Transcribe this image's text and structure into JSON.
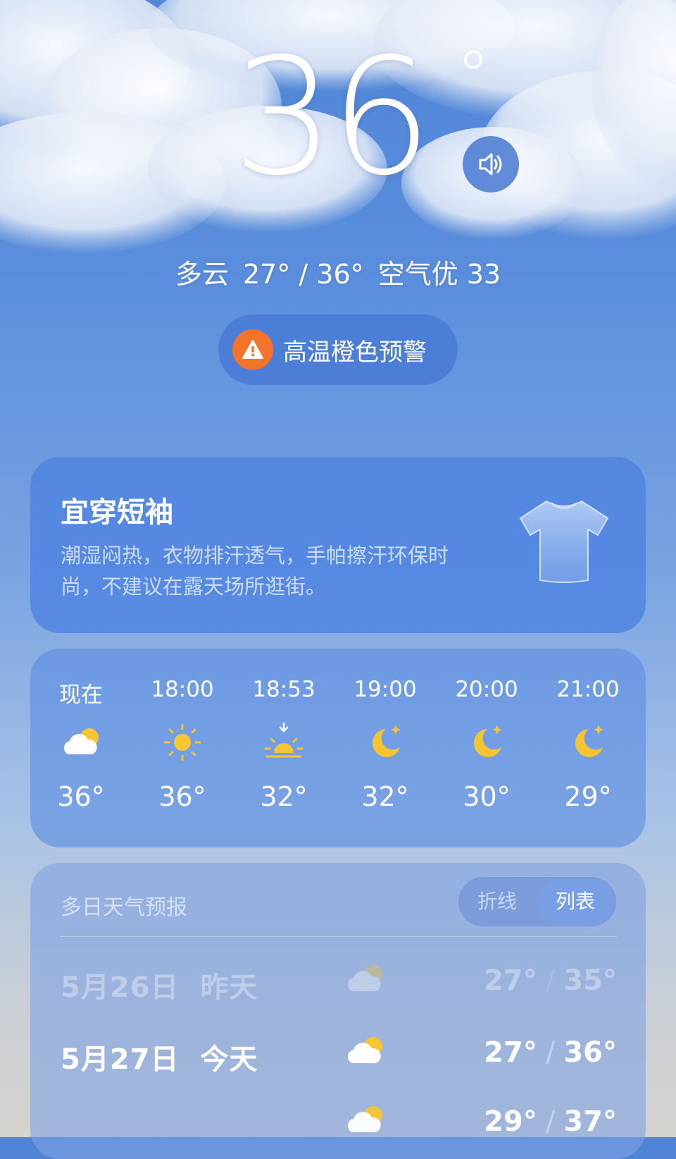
{
  "current": {
    "temperature": "36",
    "degree_symbol": "°",
    "condition": "多云",
    "range": "27° / 36°",
    "air_quality": "空气优 33"
  },
  "alert": {
    "label": "高温橙色预警",
    "color": "#f3732b"
  },
  "clothing": {
    "title": "宜穿短袖",
    "description": "潮湿闷热，衣物排汗透气，手帕擦汗环保时尚，不建议在露天场所逛街。",
    "icon": "tshirt-icon"
  },
  "hourly": [
    {
      "time": "现在",
      "icon": "partly-cloudy-icon",
      "temp": "36°"
    },
    {
      "time": "18:00",
      "icon": "sun-icon",
      "temp": "36°"
    },
    {
      "time": "18:53",
      "icon": "sunset-icon",
      "temp": "32°"
    },
    {
      "time": "19:00",
      "icon": "moon-icon",
      "temp": "32°"
    },
    {
      "time": "20:00",
      "icon": "moon-icon",
      "temp": "30°"
    },
    {
      "time": "21:00",
      "icon": "moon-icon",
      "temp": "29°"
    }
  ],
  "daily": {
    "title": "多日天气预报",
    "toggle": {
      "option_a": "折线",
      "option_b": "列表",
      "selected": "列表"
    },
    "days": [
      {
        "date": "5月26日",
        "label": "昨天",
        "icon": "partly-cloudy-icon",
        "low": "27°",
        "high": "35°",
        "separator": "/"
      },
      {
        "date": "5月27日",
        "label": "今天",
        "icon": "partly-cloudy-icon",
        "low": "27°",
        "high": "36°",
        "separator": "/"
      },
      {
        "date": "",
        "label": "",
        "icon": "partly-cloudy-icon",
        "low": "29°",
        "high": "37°",
        "separator": "/"
      }
    ]
  },
  "colors": {
    "sun": "#f7c52f",
    "alert": "#f3732b",
    "sky_top": "#4f84d6"
  }
}
